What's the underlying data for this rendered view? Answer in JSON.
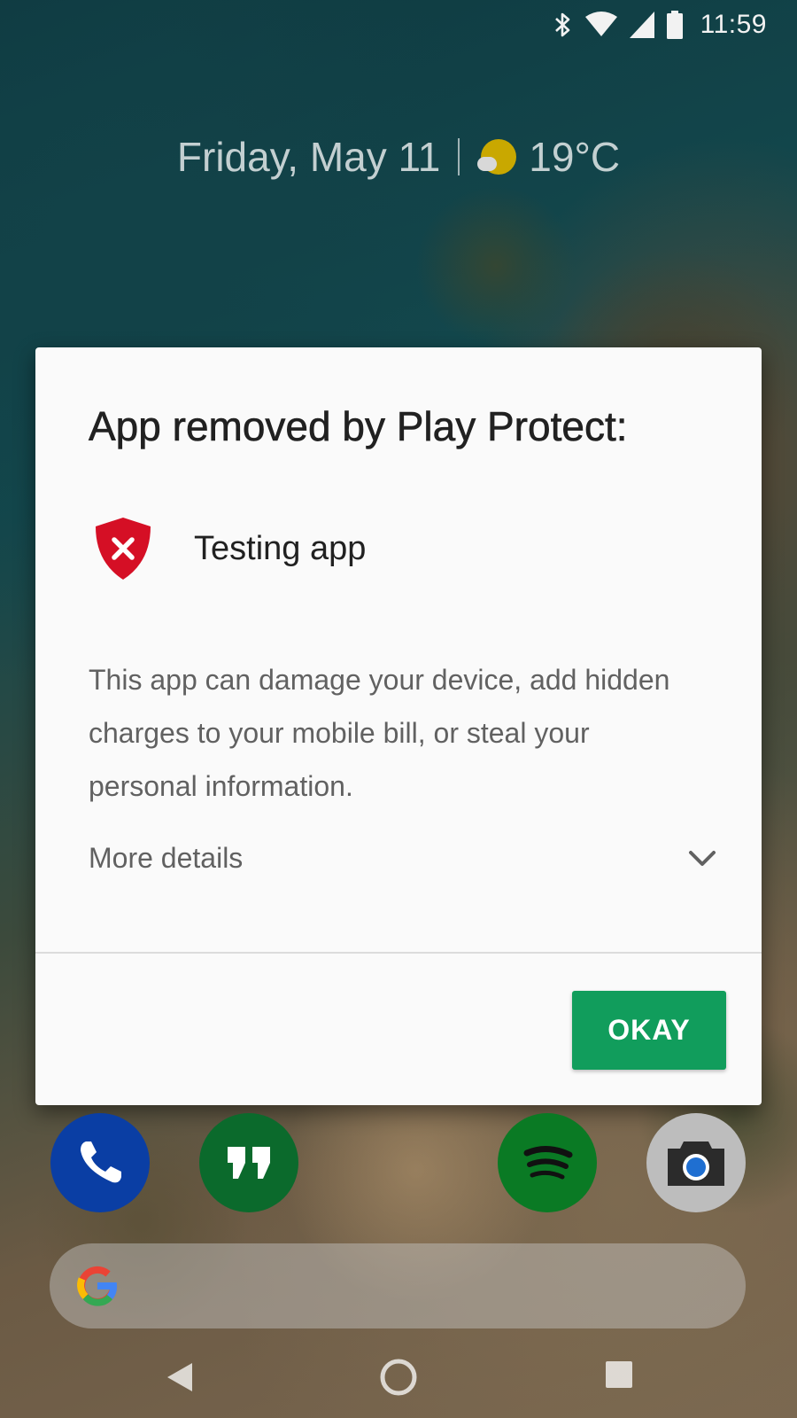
{
  "status_bar": {
    "time": "11:59",
    "icons": [
      "bluetooth-icon",
      "wifi-icon",
      "cell-signal-icon",
      "battery-icon"
    ]
  },
  "glance": {
    "date": "Friday, May 11",
    "temperature": "19°C",
    "weather_icon": "partly-sunny-icon"
  },
  "dialog": {
    "title": "App removed by Play Protect:",
    "app_name": "Testing app",
    "app_icon": "shield-x-icon",
    "message": "This app can damage your device, add hidden charges to your mobile bill, or steal your personal information.",
    "more_details_label": "More details",
    "okay_label": "OKAY",
    "colors": {
      "accent": "#119d5c",
      "shield": "#d50f25"
    }
  },
  "dock": {
    "apps": [
      "phone-icon",
      "hangouts-icon",
      "spotify-icon",
      "camera-icon"
    ]
  },
  "search": {
    "icon": "google-g-icon"
  },
  "nav": {
    "buttons": [
      "back-icon",
      "home-icon",
      "recents-icon"
    ]
  }
}
